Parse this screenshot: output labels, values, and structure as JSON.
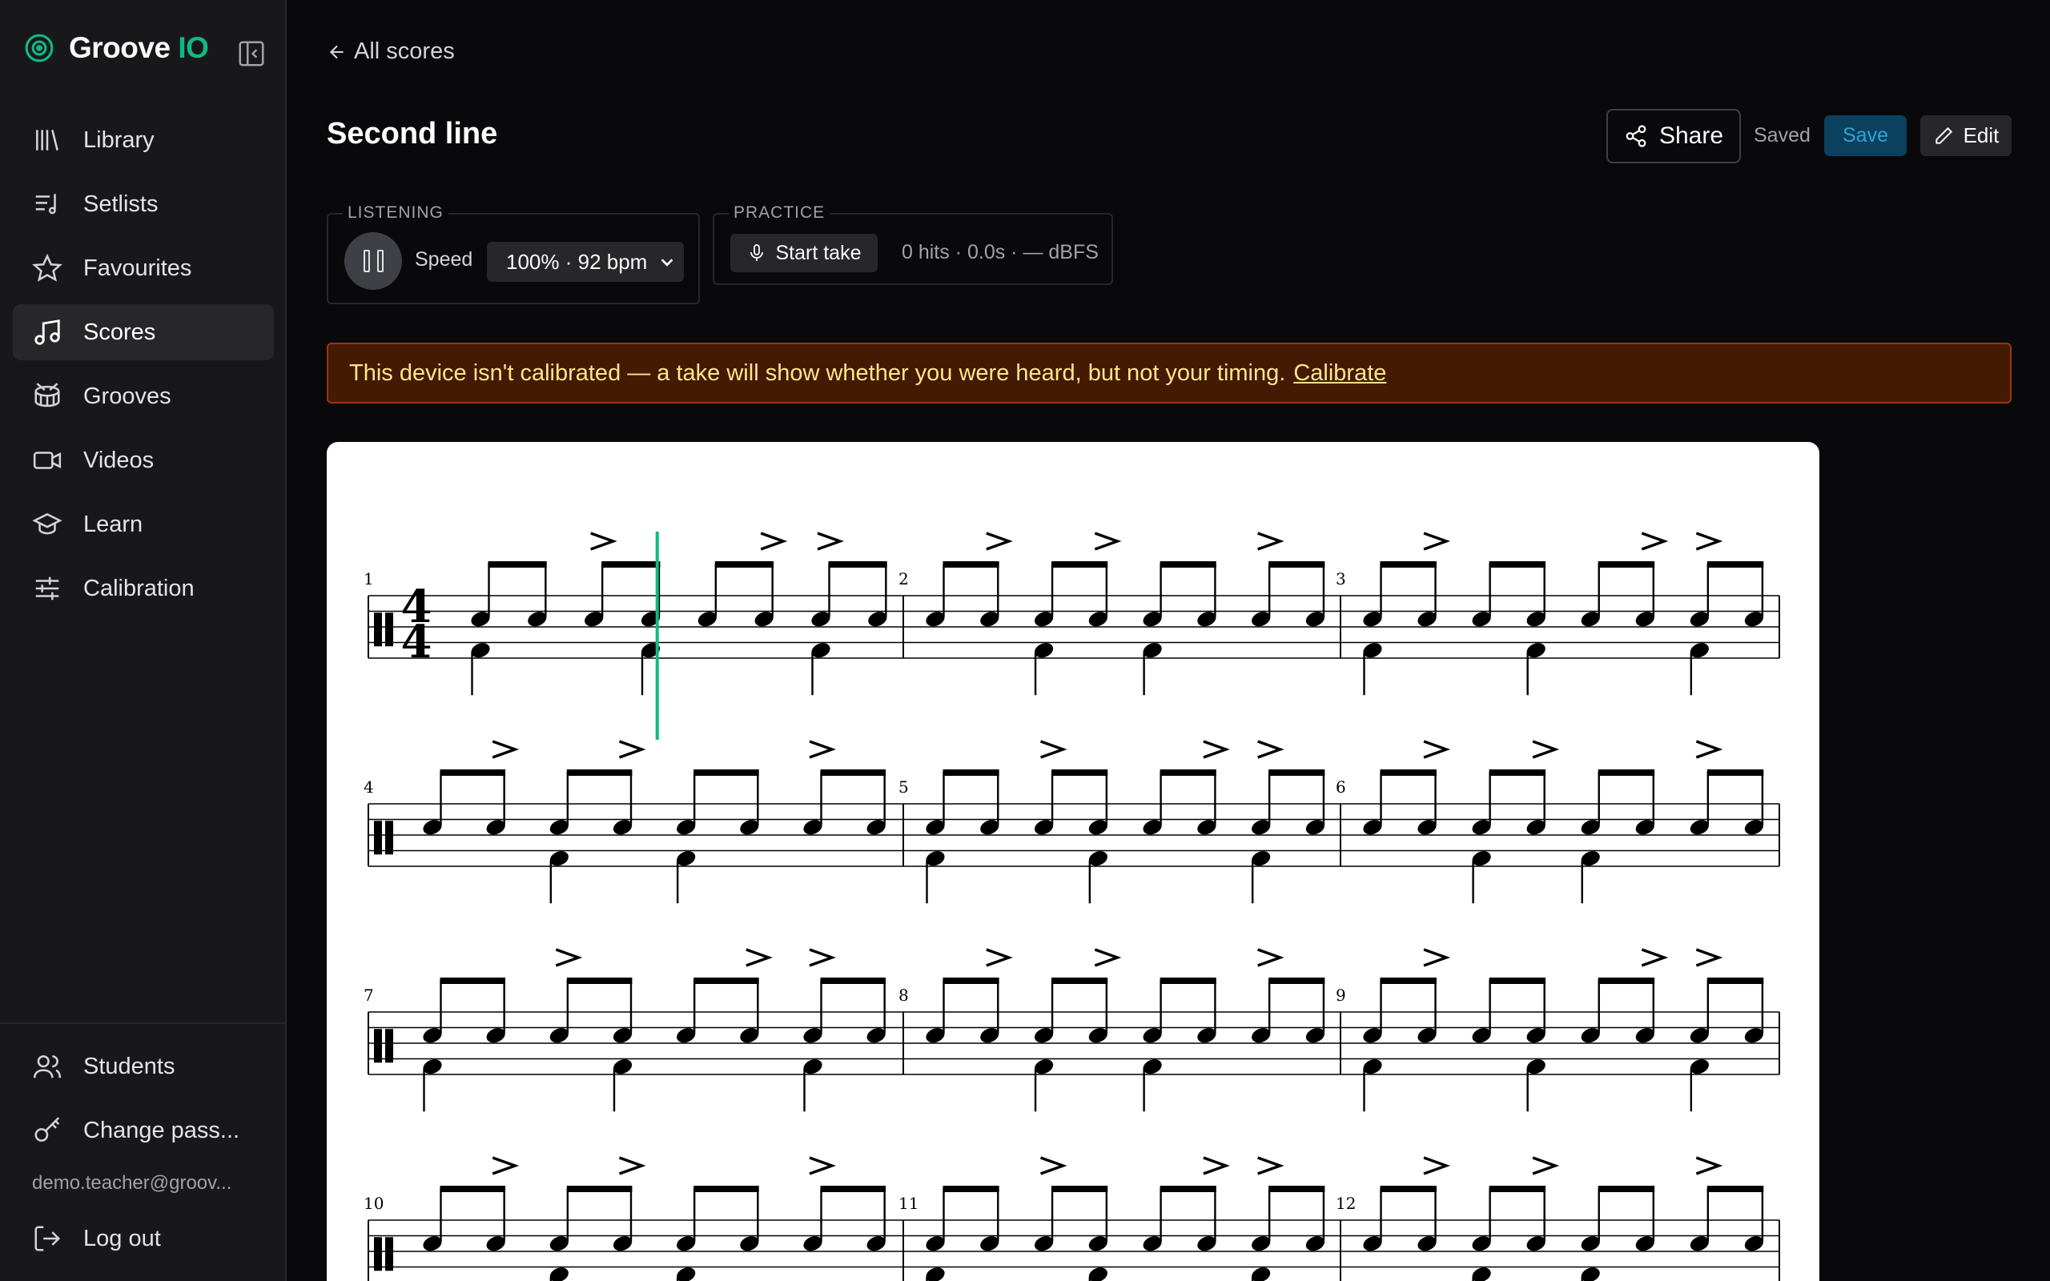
{
  "brand": {
    "name_main": "Groove",
    "name_accent": "IO"
  },
  "sidebar": {
    "items": [
      {
        "label": "Library",
        "icon": "library-icon",
        "active": false
      },
      {
        "label": "Setlists",
        "icon": "setlist-icon",
        "active": false
      },
      {
        "label": "Favourites",
        "icon": "star-icon",
        "active": false
      },
      {
        "label": "Scores",
        "icon": "music-note-icon",
        "active": true
      },
      {
        "label": "Grooves",
        "icon": "drum-icon",
        "active": false
      },
      {
        "label": "Videos",
        "icon": "video-icon",
        "active": false
      },
      {
        "label": "Learn",
        "icon": "graduation-cap-icon",
        "active": false
      },
      {
        "label": "Calibration",
        "icon": "sliders-icon",
        "active": false
      }
    ],
    "bottom_items": [
      {
        "label": "Students",
        "icon": "users-icon"
      },
      {
        "label": "Change pass...",
        "icon": "key-icon"
      }
    ],
    "user_email": "demo.teacher@groov...",
    "logout_label": "Log out"
  },
  "header": {
    "back_label": "All scores",
    "title": "Second line",
    "share_label": "Share",
    "saved_label": "Saved",
    "save_label": "Save",
    "edit_label": "Edit"
  },
  "listening": {
    "legend": "LISTENING",
    "speed_label": "Speed",
    "speed_value": "100% · 92 bpm"
  },
  "practice": {
    "legend": "PRACTICE",
    "start_label": "Start take",
    "stats": "0 hits · 0.0s · — dBFS"
  },
  "banner": {
    "message": "This device isn't calibrated — a take will show whether you were heard, but not your timing.",
    "link": "Calibrate"
  },
  "score": {
    "time_signature": [
      "4",
      "4"
    ],
    "measure_numbers": [
      "1",
      "2",
      "3",
      "4",
      "5",
      "6",
      "7",
      "8",
      "9",
      "10",
      "11",
      "12"
    ],
    "accents": [
      [
        2,
        5,
        6
      ],
      [
        1,
        3,
        6
      ],
      [
        1,
        5,
        6
      ],
      [
        1,
        3,
        6
      ],
      [
        2,
        5,
        6
      ],
      [
        1,
        3,
        6
      ],
      [
        2,
        5,
        6
      ],
      [
        1,
        3,
        6
      ],
      [
        1,
        5,
        6
      ],
      [
        1,
        3,
        6
      ],
      [
        2,
        5,
        6
      ],
      [
        1,
        3,
        6
      ]
    ],
    "kicks": [
      [
        0,
        3,
        6
      ],
      [
        2,
        4
      ],
      [
        0,
        3,
        6
      ],
      [
        2,
        4
      ],
      [
        0,
        3,
        6
      ],
      [
        2,
        4
      ],
      [
        0,
        3,
        6
      ],
      [
        2,
        4
      ],
      [
        0,
        3,
        6
      ],
      [
        2,
        4
      ],
      [
        0,
        3,
        6
      ],
      [
        2,
        4
      ]
    ],
    "playhead_measure": 1,
    "playhead_position": 0.54
  },
  "colors": {
    "accent": "#10b981",
    "playhead": "#10b981",
    "warning_bg": "#451a03",
    "warning_text": "#fde68a"
  }
}
